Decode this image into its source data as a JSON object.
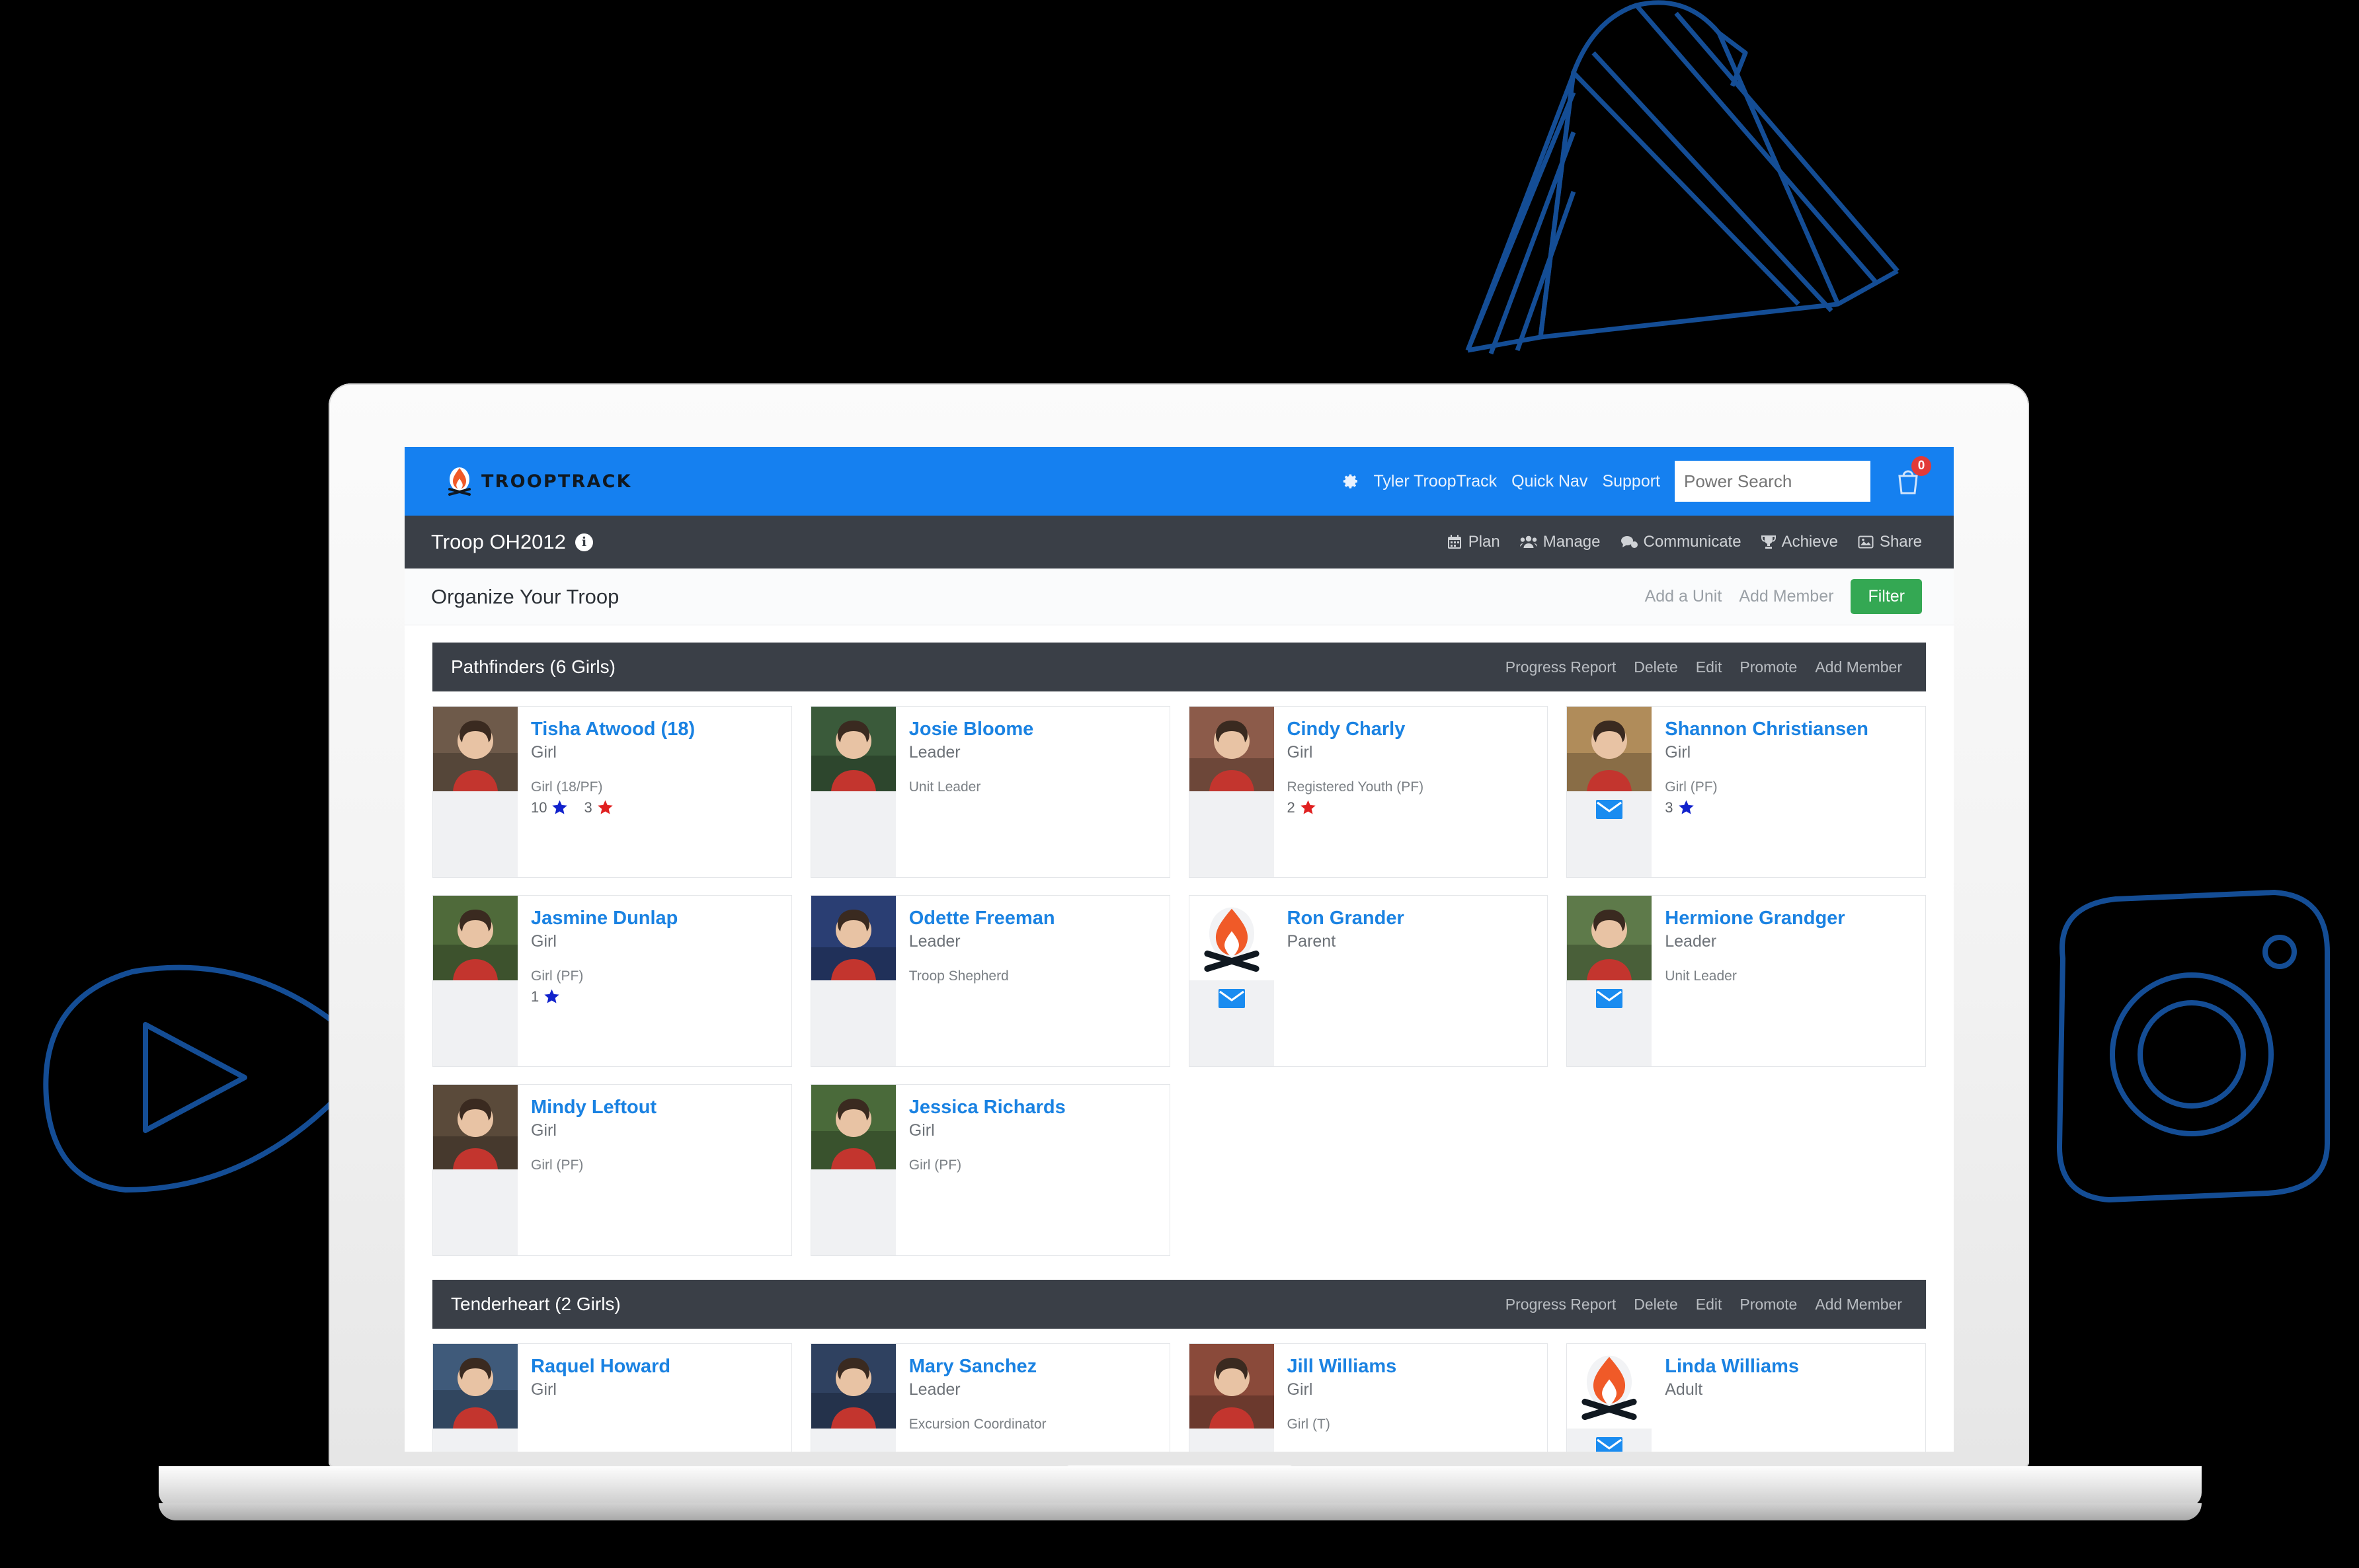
{
  "topbar": {
    "brand_name": "TROOPTRACK",
    "brand_icon": "campfire-icon",
    "gear_icon": "gear-icon",
    "links": [
      {
        "label": "Tyler TroopTrack",
        "name": "user-menu"
      },
      {
        "label": "Quick Nav",
        "name": "quick-nav"
      },
      {
        "label": "Support",
        "name": "support"
      }
    ],
    "search_placeholder": "Power Search",
    "cart_icon": "shopping-cart-icon",
    "cart_count": "0",
    "bg_color": "#1580f0"
  },
  "subbar": {
    "troop_title": "Troop OH2012",
    "info_icon": "info-icon",
    "nav": [
      {
        "label": "Plan",
        "icon": "calendar-icon"
      },
      {
        "label": "Manage",
        "icon": "users-icon"
      },
      {
        "label": "Communicate",
        "icon": "chat-icon"
      },
      {
        "label": "Achieve",
        "icon": "trophy-icon"
      },
      {
        "label": "Share",
        "icon": "image-icon"
      }
    ],
    "bg_color": "#3a3f47"
  },
  "pagebar": {
    "title": "Organize Your Troop",
    "add_unit_label": "Add a Unit",
    "add_member_label": "Add Member",
    "filter_label": "Filter",
    "filter_color": "#34a853"
  },
  "units": [
    {
      "name": "Pathfinders (6 Girls)",
      "actions": [
        "Progress Report",
        "Delete",
        "Edit",
        "Promote",
        "Add Member"
      ],
      "members": [
        {
          "name": "Tisha Atwood (18)",
          "role": "Girl",
          "meta": "Girl (18/PF)",
          "avatar": "photo",
          "avatar_tone": "#6e5a4a",
          "mail": false,
          "stars": [
            {
              "count": "10",
              "color": "#1122cc"
            },
            {
              "count": "3",
              "color": "#e02020"
            }
          ]
        },
        {
          "name": "Josie Bloome",
          "role": "Leader",
          "meta": "Unit Leader",
          "avatar": "photo",
          "avatar_tone": "#3a5a3a",
          "mail": false,
          "stars": []
        },
        {
          "name": "Cindy Charly",
          "role": "Girl",
          "meta": "Registered Youth (PF)",
          "avatar": "photo",
          "avatar_tone": "#8c5b4a",
          "mail": false,
          "stars": [
            {
              "count": "2",
              "color": "#e02020"
            }
          ]
        },
        {
          "name": "Shannon Christiansen",
          "role": "Girl",
          "meta": "Girl (PF)",
          "avatar": "photo",
          "avatar_tone": "#b08c5a",
          "mail": true,
          "stars": [
            {
              "count": "3",
              "color": "#1122cc"
            }
          ]
        },
        {
          "name": "Jasmine Dunlap",
          "role": "Girl",
          "meta": "Girl (PF)",
          "avatar": "photo",
          "avatar_tone": "#4f6a3a",
          "mail": false,
          "stars": [
            {
              "count": "1",
              "color": "#1122cc"
            }
          ]
        },
        {
          "name": "Odette Freeman",
          "role": "Leader",
          "meta": "Troop Shepherd",
          "avatar": "photo",
          "avatar_tone": "#2a3e73",
          "mail": false,
          "stars": []
        },
        {
          "name": "Ron Grander",
          "role": "Parent",
          "meta": "",
          "avatar": "campfire",
          "mail": true,
          "stars": []
        },
        {
          "name": "Hermione Grandger",
          "role": "Leader",
          "meta": "Unit Leader",
          "avatar": "photo",
          "avatar_tone": "#5e7a4a",
          "mail": true,
          "stars": []
        },
        {
          "name": "Mindy Leftout",
          "role": "Girl",
          "meta": "Girl (PF)",
          "avatar": "photo",
          "avatar_tone": "#5a4a3a",
          "mail": false,
          "stars": []
        },
        {
          "name": "Jessica Richards",
          "role": "Girl",
          "meta": "Girl (PF)",
          "avatar": "photo",
          "avatar_tone": "#4a6a3a",
          "mail": false,
          "stars": []
        }
      ]
    },
    {
      "name": "Tenderheart (2 Girls)",
      "actions": [
        "Progress Report",
        "Delete",
        "Edit",
        "Promote",
        "Add Member"
      ],
      "members": [
        {
          "name": "Raquel Howard",
          "role": "Girl",
          "meta": "",
          "avatar": "photo",
          "avatar_tone": "#3f5a7a",
          "mail": false,
          "stars": []
        },
        {
          "name": "Mary Sanchez",
          "role": "Leader",
          "meta": "Excursion Coordinator",
          "avatar": "photo",
          "avatar_tone": "#2f4160",
          "mail": false,
          "stars": []
        },
        {
          "name": "Jill Williams",
          "role": "Girl",
          "meta": "Girl (T)",
          "avatar": "photo",
          "avatar_tone": "#8a4a3a",
          "mail": false,
          "stars": []
        },
        {
          "name": "Linda Williams",
          "role": "Adult",
          "meta": "",
          "avatar": "campfire",
          "mail": true,
          "stars": []
        }
      ]
    }
  ]
}
